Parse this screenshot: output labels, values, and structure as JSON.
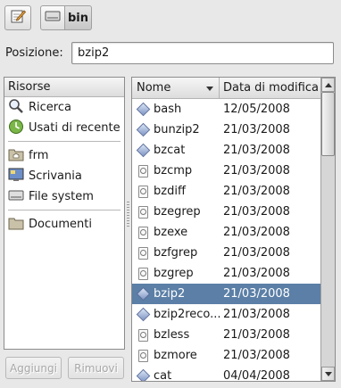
{
  "toolbar": {
    "edit_icon": "edit-pencil-icon",
    "path_root_icon": "drive-icon",
    "current_folder": "bin"
  },
  "location": {
    "label": "Posizione:",
    "value": "bzip2"
  },
  "places": {
    "header": "Risorse",
    "items": [
      {
        "label": "Ricerca",
        "icon": "search-icon"
      },
      {
        "label": "Usati di recente",
        "icon": "recent-icon"
      },
      {
        "label": "frm",
        "icon": "home-folder-icon"
      },
      {
        "label": "Scrivania",
        "icon": "desktop-icon"
      },
      {
        "label": "File system",
        "icon": "drive-icon"
      },
      {
        "label": "Documenti",
        "icon": "folder-icon"
      }
    ],
    "add_label": "Aggiungi",
    "remove_label": "Rimuovi"
  },
  "files": {
    "col_name": "Nome",
    "col_date": "Data di modifica",
    "rows": [
      {
        "name": "bash",
        "date": "12/05/2008",
        "icon": "executable-icon"
      },
      {
        "name": "bunzip2",
        "date": "21/03/2008",
        "icon": "executable-icon"
      },
      {
        "name": "bzcat",
        "date": "21/03/2008",
        "icon": "executable-icon"
      },
      {
        "name": "bzcmp",
        "date": "21/03/2008",
        "icon": "script-icon"
      },
      {
        "name": "bzdiff",
        "date": "21/03/2008",
        "icon": "script-icon"
      },
      {
        "name": "bzegrep",
        "date": "21/03/2008",
        "icon": "script-icon"
      },
      {
        "name": "bzexe",
        "date": "21/03/2008",
        "icon": "script-icon"
      },
      {
        "name": "bzfgrep",
        "date": "21/03/2008",
        "icon": "script-icon"
      },
      {
        "name": "bzgrep",
        "date": "21/03/2008",
        "icon": "script-icon"
      },
      {
        "name": "bzip2",
        "date": "21/03/2008",
        "icon": "executable-icon",
        "selected": true
      },
      {
        "name": "bzip2reco...",
        "date": "21/03/2008",
        "icon": "executable-icon"
      },
      {
        "name": "bzless",
        "date": "21/03/2008",
        "icon": "script-icon"
      },
      {
        "name": "bzmore",
        "date": "21/03/2008",
        "icon": "script-icon"
      },
      {
        "name": "cat",
        "date": "04/04/2008",
        "icon": "executable-icon"
      }
    ]
  },
  "colors": {
    "selection": "#5b7fa6",
    "background": "#e8e8e8"
  }
}
